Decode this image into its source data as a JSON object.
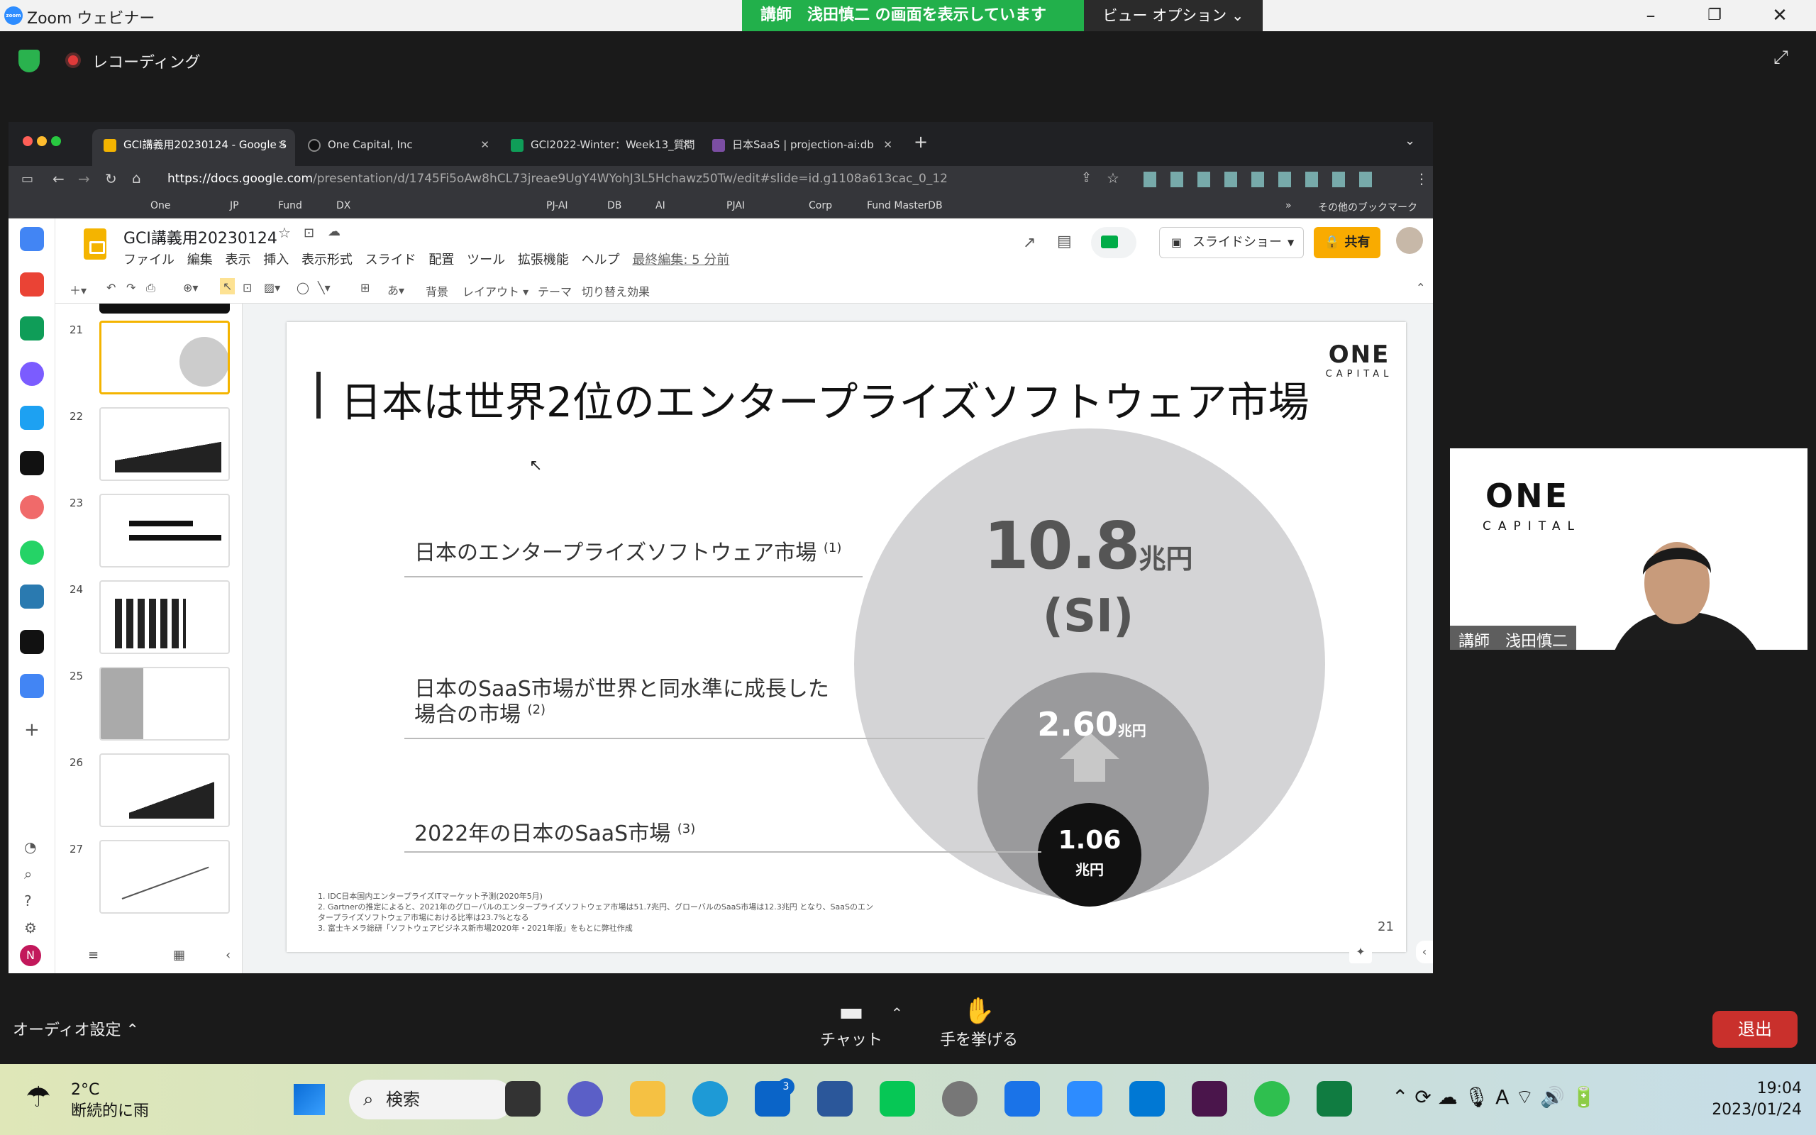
{
  "zoom": {
    "window_title": "Zoom ウェビナー",
    "share_banner": "講師　浅田慎二 の画面を表示しています",
    "view_options": "ビュー オプション ⌄",
    "recording": "レコーディング",
    "audio_settings": "オーディオ設定",
    "chat": "チャット",
    "raise_hand": "手を挙げる",
    "leave": "退出",
    "speaker_name": "講師　浅田慎二",
    "video_logo": "ONE",
    "video_logo_sub": "CAPITAL"
  },
  "browser": {
    "tabs": [
      {
        "label": "GCI講義用20230124 - Google S",
        "color": "#f4b400"
      },
      {
        "label": "One Capital, Inc",
        "color": "#222222"
      },
      {
        "label": "GCI2022-Winter：Week13_質問",
        "color": "#0f9d58"
      },
      {
        "label": "日本SaaS | projection-ai:db",
        "color": "#7b4ea3"
      }
    ],
    "url_domain": "https://docs.google.com",
    "url_path": "/presentation/d/1745Fi5oAw8hCL73jreae9UgY4WYohJ3L5Hchawz50Tw/edit#slide=id.g1108a613cac_0_12",
    "bookmarks": [
      "One",
      "JP",
      "Fund",
      "DX",
      "PJ-AI",
      "DB",
      "AI",
      "PJAI",
      "Corp",
      "Fund MasterDB",
      "»",
      "その他のブックマーク"
    ]
  },
  "docs": {
    "title": "GCI講義用20230124",
    "menu": [
      "ファイル",
      "編集",
      "表示",
      "挿入",
      "表示形式",
      "スライド",
      "配置",
      "ツール",
      "拡張機能",
      "ヘルプ"
    ],
    "last_edit": "最終編集: 5 分前",
    "toolbar": [
      "背景",
      "レイアウト ▾",
      "テーマ",
      "切り替え効果"
    ],
    "slideshow": "スライドショー",
    "share": "共有",
    "thumbnails": [
      "21",
      "22",
      "23",
      "24",
      "25",
      "26",
      "27"
    ]
  },
  "slide": {
    "title": "日本は世界2位のエンタープライズソフトウェア市場",
    "logo": "ONE",
    "logo_sub": "CAPITAL",
    "row1": "日本のエンタープライズソフトウェア市場",
    "row1_note": "(1)",
    "row2_line1": "日本のSaaS市場が世界と同水準に成長した",
    "row2_line2": "場合の市場",
    "row2_note": "(2)",
    "row3": "2022年の日本のSaaS市場",
    "row3_note": "(3)",
    "value1_num": "10.8",
    "value1_unit": "兆円",
    "value1_sub": "(SI)",
    "value2_num": "2.60",
    "value2_unit": "兆円",
    "value3_num": "1.06",
    "value3_unit": "兆円",
    "footnote1": "1.  IDC日本国内エンタープライズITマーケット予測(2020年5月)",
    "footnote2": "2.  Gartnerの推定によると、2021年のグローバルのエンタープライズソフトウェア市場は51.7兆円、グローバルのSaaS市場は12.3兆円 となり、SaaSのエン",
    "footnote2b": "     タープライズソフトウェア市場における比率は23.7%となる",
    "footnote3": "3.  富士キメラ総研「ソフトウェアビジネス新市場2020年・2021年版」をもとに弊社作成",
    "page": "21"
  },
  "taskbar": {
    "temperature": "2°C",
    "weather": "断続的に雨",
    "search": "検索",
    "mail_badge": "3",
    "time": "19:04",
    "date": "2023/01/24"
  }
}
